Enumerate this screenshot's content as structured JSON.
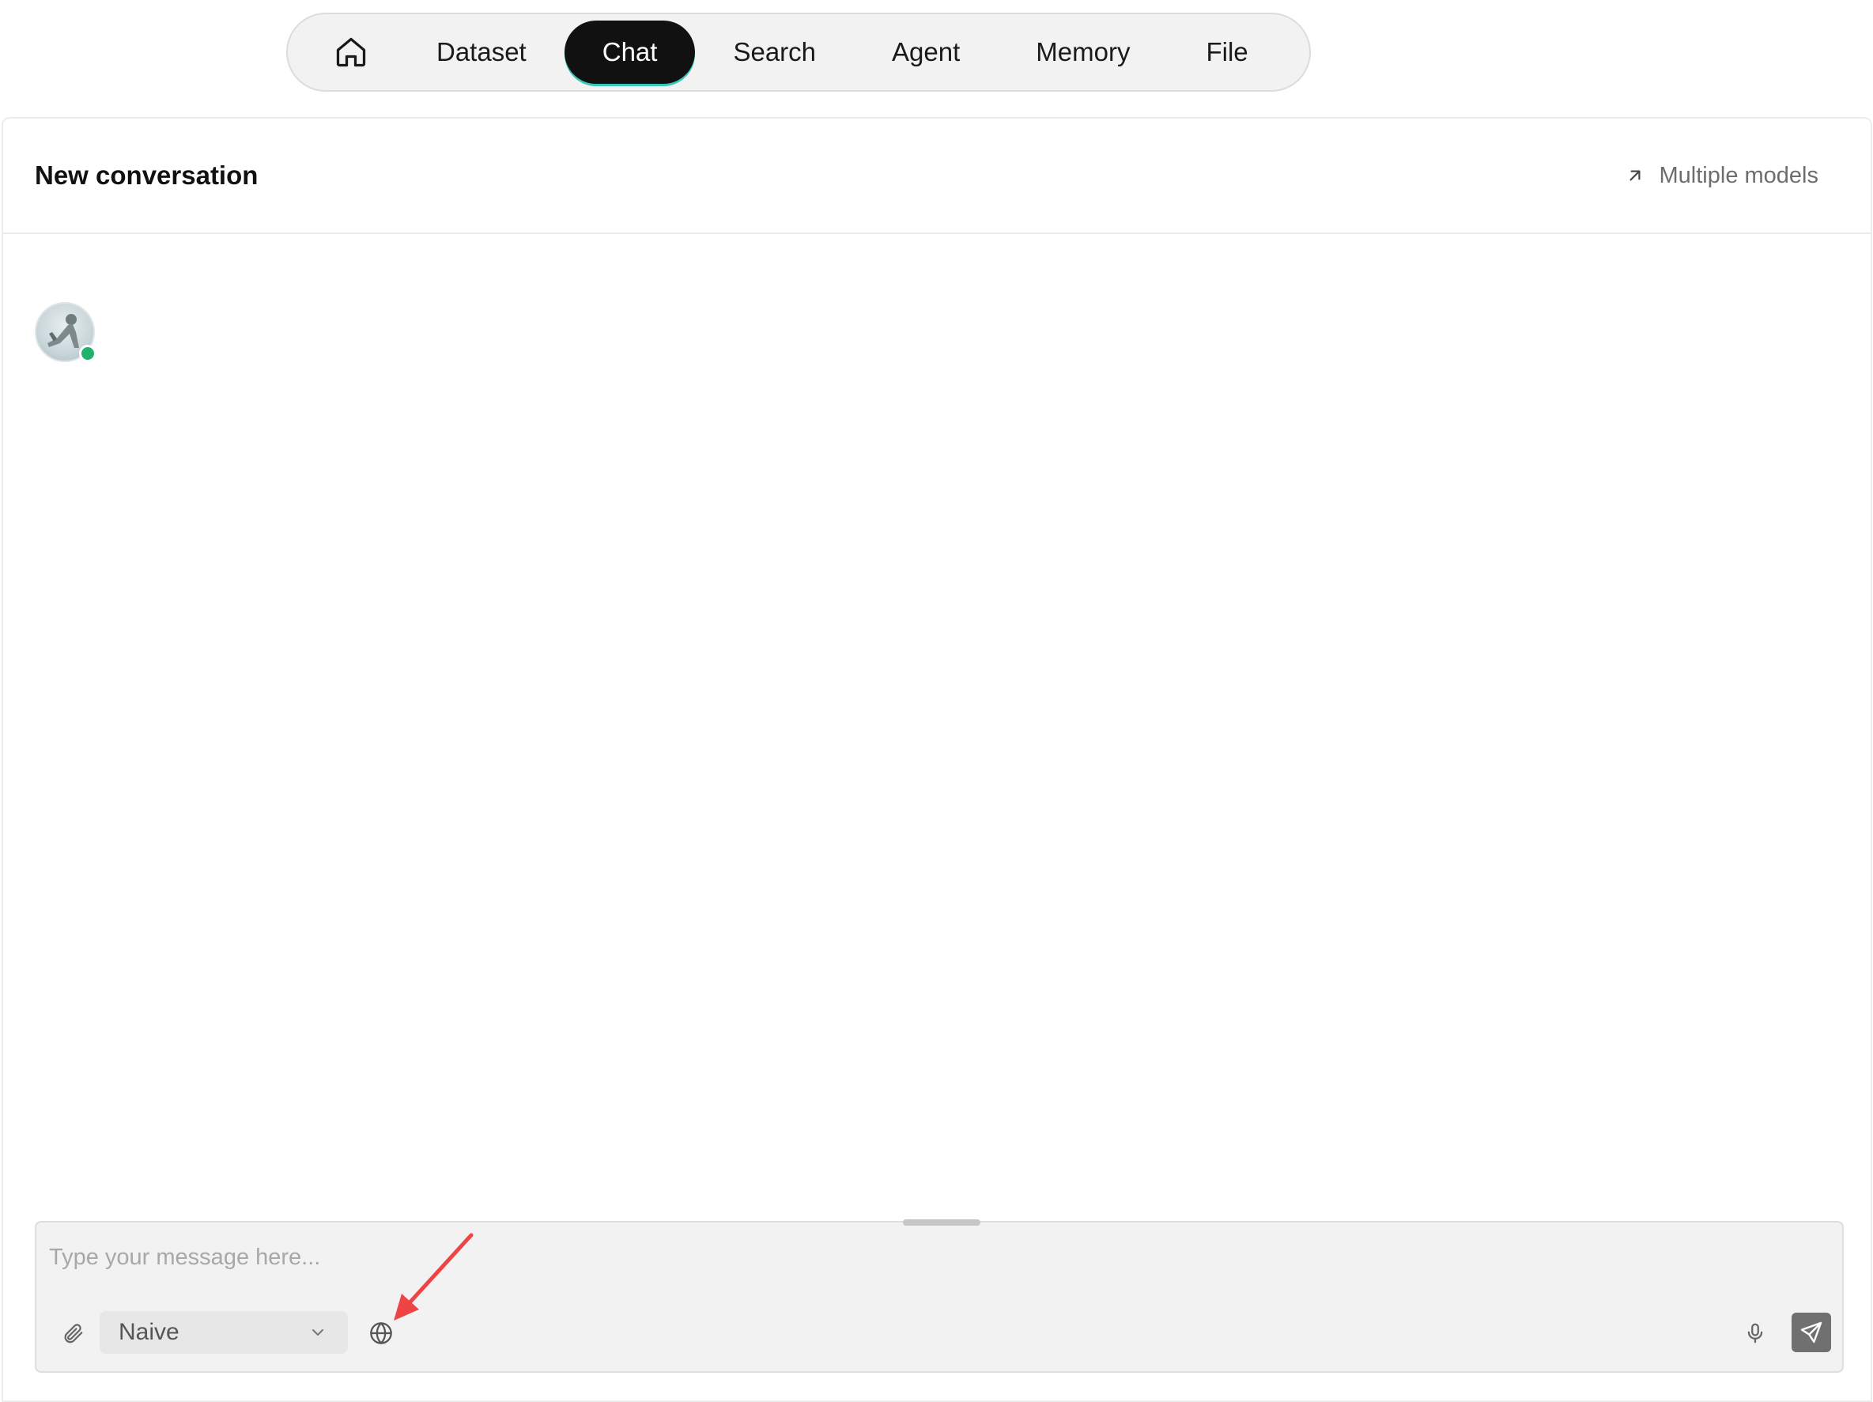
{
  "nav": {
    "home_icon": "home-icon",
    "tabs": [
      {
        "label": "Dataset",
        "active": false
      },
      {
        "label": "Chat",
        "active": true
      },
      {
        "label": "Search",
        "active": false
      },
      {
        "label": "Agent",
        "active": false
      },
      {
        "label": "Memory",
        "active": false
      },
      {
        "label": "File",
        "active": false
      }
    ],
    "active_color": "#111111",
    "active_underline_color": "#36c7b6"
  },
  "header": {
    "title": "New conversation",
    "multiple_models_label": "Multiple models",
    "multiple_models_icon": "arrow-up-right-icon"
  },
  "assistant": {
    "avatar_icon": "avatar",
    "status": "online",
    "status_color": "#1fb36a"
  },
  "composer": {
    "placeholder": "Type your message here...",
    "value": "",
    "mode_select": {
      "selected": "Naive"
    },
    "icons": {
      "attach": "paperclip-icon",
      "web_search": "globe-icon",
      "voice": "microphone-icon",
      "send": "send-icon",
      "dropdown": "chevron-down-icon"
    }
  },
  "annotation": {
    "icon": "arrow-annotation-icon",
    "color": "#ef4444"
  }
}
